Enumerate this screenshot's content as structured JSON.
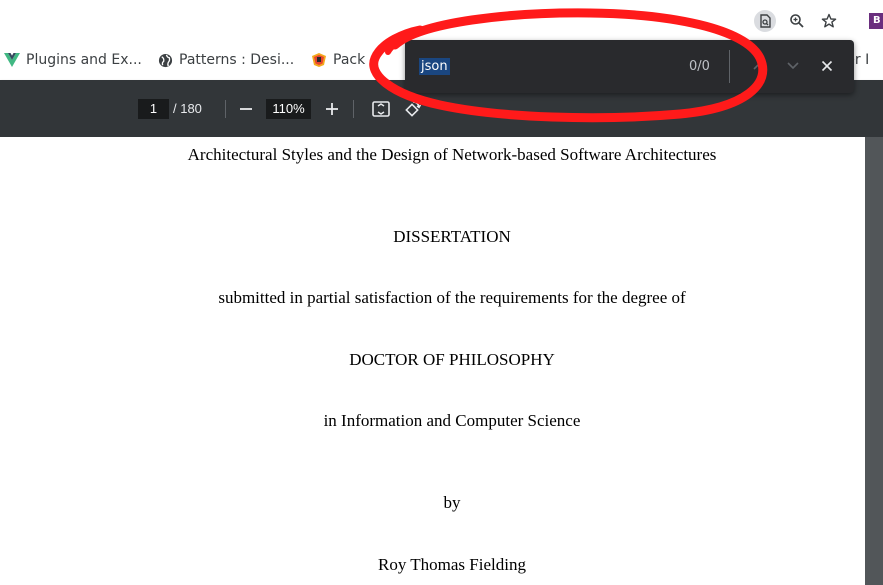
{
  "toolbar_icons": [
    "find-in-page-icon",
    "zoom-icon",
    "star-icon"
  ],
  "extension": {
    "letter": "B",
    "color": "#6a2e7e"
  },
  "bookmarks": [
    {
      "label": "Plugins and Ex...",
      "icon": "vue-logo-icon",
      "color": "#41b883"
    },
    {
      "label": "Patterns : Desi...",
      "icon": "globe-icon",
      "color": "#3c4043"
    },
    {
      "label": "Pack",
      "icon": "packt-logo-icon",
      "color": "#e8442e"
    },
    {
      "label": "ver I",
      "icon": "",
      "color": "#3c4043"
    }
  ],
  "pdf_toolbar": {
    "page_current": "1",
    "page_total": "/ 180",
    "zoom": "110%",
    "background": "#323639"
  },
  "find_bar": {
    "query": "json",
    "count": "0/0",
    "background": "#292a2d",
    "highlight": "#1a4680"
  },
  "document": {
    "title": "Architectural Styles and the Design of Network-based Software Architectures",
    "type": "DISSERTATION",
    "submitted": "submitted in partial satisfaction of the requirements for the degree of",
    "degree": "DOCTOR OF PHILOSOPHY",
    "field": "in Information and Computer Science",
    "by": "by",
    "author": "Roy Thomas Fielding"
  },
  "annotation": {
    "shape": "hand-drawn ellipse",
    "color": "#ff1a1a"
  }
}
